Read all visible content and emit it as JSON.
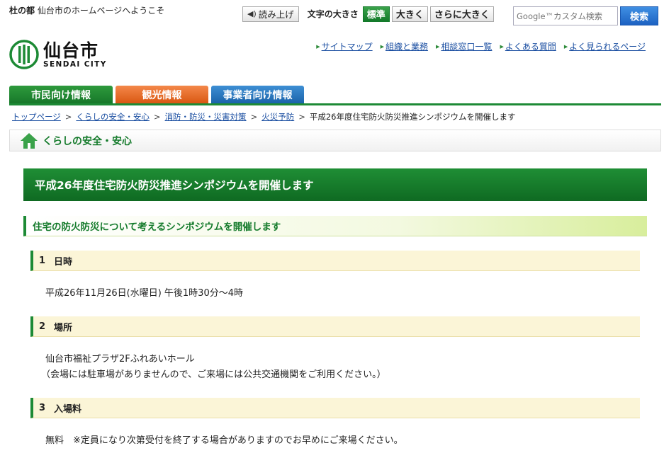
{
  "header": {
    "tagline_bold": "杜の都",
    "tagline_rest": "仙台市のホームページへようこそ",
    "read_aloud": "読み上げ",
    "font_size_label": "文字の大きさ",
    "font_sizes": [
      "標準",
      "大きく",
      "さらに大きく"
    ],
    "search_placeholder": "Google™カスタム検索",
    "search_button": "検索",
    "logo_jp": "仙台市",
    "logo_en": "SENDAI CITY",
    "utility_links": [
      "サイトマップ",
      "組織と業務",
      "相談窓口一覧",
      "よくある質問",
      "よく見られるページ"
    ],
    "colors": {
      "green": "#1d8a35",
      "orange": "#e8692a",
      "blue": "#2a79c4",
      "link": "#1a4ea1"
    }
  },
  "tabs": [
    "市民向け情報",
    "観光情報",
    "事業者向け情報"
  ],
  "breadcrumb": [
    "トップページ",
    "くらしの安全・安心",
    "消防・防災・災害対策",
    "火災予防",
    "平成26年度住宅防火防災推進シンポジウムを開催します"
  ],
  "category": "くらしの安全・安心",
  "page_title": "平成26年度住宅防火防災推進シンポジウムを開催します",
  "sub_heading": "住宅の防火防災について考えるシンポジウムを開催します",
  "sections": [
    {
      "num": "1",
      "title": "日時",
      "lines": [
        "平成26年11月26日(水曜日)  午後1時30分～4時"
      ]
    },
    {
      "num": "2",
      "title": "場所",
      "lines": [
        "仙台市福祉プラザ2Fふれあいホール",
        "（会場には駐車場がありませんので、ご来場には公共交通機関をご利用ください。）"
      ]
    },
    {
      "num": "3",
      "title": "入場料",
      "lines": [
        "無料　※定員になり次第受付を終了する場合がありますのでお早めにご来場ください。"
      ]
    }
  ]
}
